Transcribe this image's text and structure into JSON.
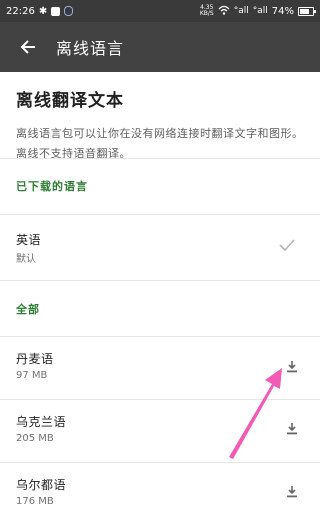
{
  "status_bar": {
    "time": "22:26",
    "left_icons": [
      "bluetooth-icon",
      "app-badge-icon",
      "sync-icon"
    ],
    "net_speed_value": "4.35",
    "net_speed_unit": "KB/S",
    "signal_labels": [
      "°all",
      "°all"
    ],
    "battery": "74%"
  },
  "app_bar": {
    "back_icon": "arrow-back-icon",
    "title": "离线语言"
  },
  "header": {
    "title": "离线翻译文本",
    "description": "离线语言包可以让你在没有网络连接时翻译文字和图形。离线不支持语音翻译。"
  },
  "downloaded_section": {
    "label": "已下载的语言",
    "items": [
      {
        "name": "英语",
        "sub": "默认",
        "icon": "checkmark-icon"
      }
    ]
  },
  "all_section": {
    "label": "全部",
    "items": [
      {
        "name": "丹麦语",
        "size": "97 MB",
        "icon": "download-icon"
      },
      {
        "name": "乌克兰语",
        "size": "205 MB",
        "icon": "download-icon"
      },
      {
        "name": "乌尔都语",
        "size": "176 MB",
        "icon": "download-icon"
      }
    ]
  },
  "colors": {
    "status_bar": "#3a3a3a",
    "app_bar": "#424242",
    "section_label": "#2e7d32",
    "annotation_arrow": "#f25ab5"
  }
}
